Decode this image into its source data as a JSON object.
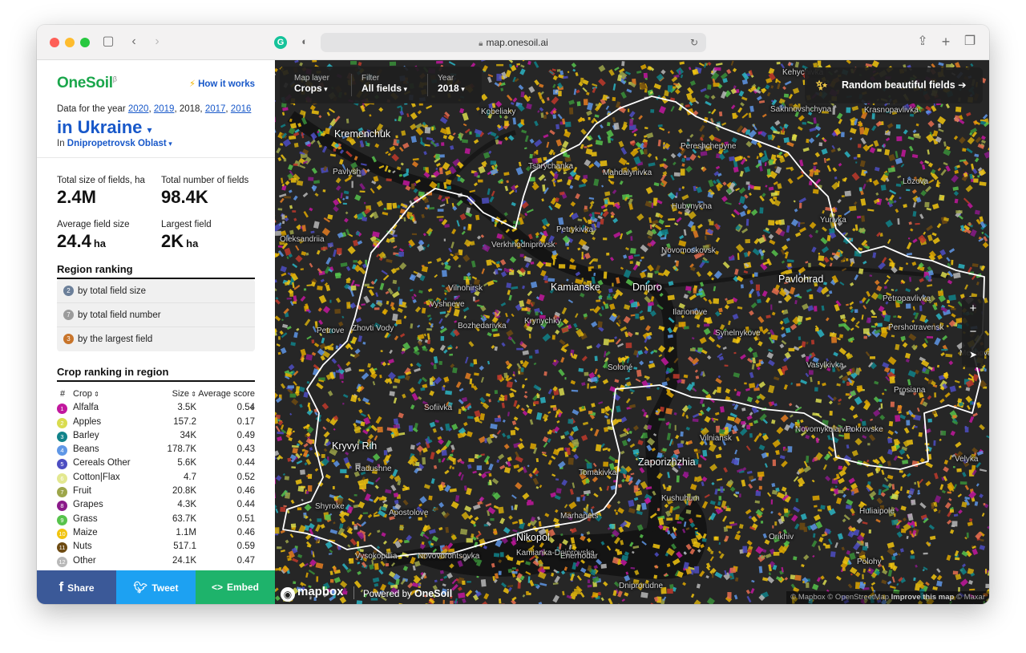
{
  "browser": {
    "url": "map.onesoil.ai"
  },
  "sidebar": {
    "logo": "OneSoil",
    "logo_badge": "β",
    "how_it_works": "How it works",
    "data_prefix": "Data for the year",
    "years": [
      "2020",
      "2019",
      "2018",
      "2017",
      "2016"
    ],
    "country": "in Ukraine",
    "region_prefix": "In",
    "region": "Dnipropetrovsk Oblast",
    "stats": [
      {
        "label": "Total size of fields, ha",
        "value": "2.4M",
        "unit": ""
      },
      {
        "label": "Total number of fields",
        "value": "98.4K",
        "unit": ""
      },
      {
        "label": "Average field size",
        "value": "24.4",
        "unit": "ha"
      },
      {
        "label": "Largest field",
        "value": "2K",
        "unit": "ha"
      }
    ],
    "region_ranking": {
      "title": "Region ranking",
      "items": [
        {
          "rank": "2",
          "label": "by total field size",
          "color": "#6b7f99"
        },
        {
          "rank": "7",
          "label": "by total field number",
          "color": "#9b9b9b"
        },
        {
          "rank": "3",
          "label": "by the largest field",
          "color": "#c8742a"
        }
      ]
    },
    "crop_ranking": {
      "title": "Crop ranking in region",
      "headers": {
        "num": "#",
        "crop": "Crop",
        "size": "Size",
        "score": "Average score"
      },
      "rows": [
        {
          "n": "1",
          "crop": "Alfalfa",
          "size": "3.5K",
          "score": "0.54",
          "color": "#c2189e"
        },
        {
          "n": "2",
          "crop": "Apples",
          "size": "157.2",
          "score": "0.17",
          "color": "#d9dc4f"
        },
        {
          "n": "3",
          "crop": "Barley",
          "size": "34K",
          "score": "0.49",
          "color": "#11838a"
        },
        {
          "n": "4",
          "crop": "Beans",
          "size": "178.7K",
          "score": "0.43",
          "color": "#5f97e6"
        },
        {
          "n": "5",
          "crop": "Cereals Other",
          "size": "5.6K",
          "score": "0.44",
          "color": "#4d4ec2"
        },
        {
          "n": "6",
          "crop": "Cotton|Flax",
          "size": "4.7",
          "score": "0.52",
          "color": "#e3e890"
        },
        {
          "n": "7",
          "crop": "Fruit",
          "size": "20.8K",
          "score": "0.46",
          "color": "#9da64a"
        },
        {
          "n": "8",
          "crop": "Grapes",
          "size": "4.3K",
          "score": "0.44",
          "color": "#8b1a8a"
        },
        {
          "n": "9",
          "crop": "Grass",
          "size": "63.7K",
          "score": "0.51",
          "color": "#57c34c"
        },
        {
          "n": "10",
          "crop": "Maize",
          "size": "1.1M",
          "score": "0.46",
          "color": "#f1c40f"
        },
        {
          "n": "11",
          "crop": "Nuts",
          "size": "517.1",
          "score": "0.59",
          "color": "#6e4b12"
        },
        {
          "n": "12",
          "crop": "Other",
          "size": "24.1K",
          "score": "0.47",
          "color": "#b8b8b8"
        }
      ]
    },
    "share": {
      "share": "Share",
      "tweet": "Tweet",
      "embed": "Embed"
    }
  },
  "map": {
    "controls": {
      "layer_label": "Map layer",
      "layer_value": "Crops",
      "filter_label": "Filter",
      "filter_value": "All fields",
      "year_label": "Year",
      "year_value": "2018"
    },
    "random_button": "Random beautiful fields ➔",
    "zoom_in": "+",
    "zoom_out": "−",
    "labels": [
      "Kremenchuk",
      "Kobeliaky",
      "Sakhnovshchyna",
      "Krasnopavlivka",
      "Kehychivka",
      "Pereshchepyne",
      "Tsarychanka",
      "Mahdalynivka",
      "Lozova",
      "Pavlysh",
      "Hubynykha",
      "Petrykivka",
      "Yurivka",
      "Oleksandriia",
      "Verkhnodniprovsk",
      "Novomoskovsk",
      "Pavlohrad",
      "Vilnohirsk",
      "Kamianske",
      "Dnipro",
      "Petropavlivka",
      "Vyshneve",
      "Ilarionove",
      "Petrove",
      "Zhovti Vody",
      "Bozhedarivka",
      "Krynychky",
      "Synelnykove",
      "Pershotravensk",
      "Mezhova",
      "Soloné",
      "Vasylkivka",
      "Prosiana",
      "Sofiivka",
      "Vilniansk",
      "Novomykolaivka",
      "Pokrovske",
      "Kryvyi Rih",
      "Zaporizhzhia",
      "Velyka",
      "Radushne",
      "Tomakivka",
      "Shyroke",
      "Kushuhum",
      "Apostolove",
      "Marhanets",
      "Huliaipole",
      "Nikopol",
      "Orikhiv",
      "Kamianka-Dniprovska",
      "Enerhodar",
      "Vysokopillia",
      "Novovorontsovka",
      "Polohy",
      "Dniprorudne"
    ],
    "big_labels": [
      "Kremenchuk",
      "Dnipro",
      "Kamianske",
      "Pavlohrad",
      "Zaporizhzhia",
      "Nikopol",
      "Kryvyi Rih"
    ],
    "mapbox": "mapbox",
    "powered_by": "Powered by",
    "powered_brand": "OneSoil",
    "attribution_1": "© Mapbox © OpenStreetMap",
    "attribution_improve": "Improve this map",
    "attribution_2": "© Maxar"
  }
}
